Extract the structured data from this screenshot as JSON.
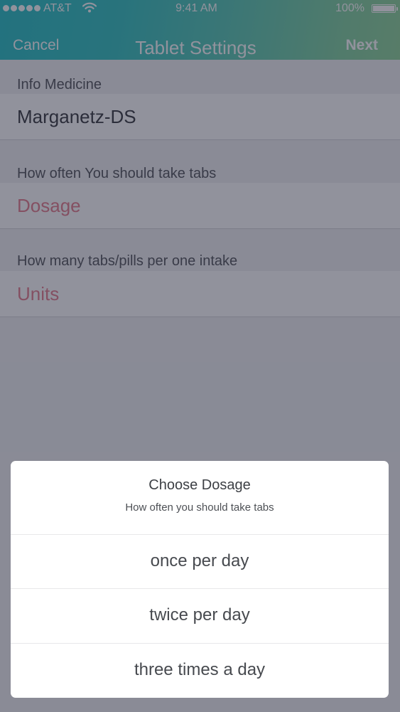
{
  "status_bar": {
    "carrier": "AT&T",
    "time": "9:41 AM",
    "battery": "100%",
    "battery_level": 1.0,
    "wifi_icon": "wifi-icon",
    "signal_icon": "signal-dots-icon"
  },
  "nav": {
    "cancel_label": "Cancel",
    "title": "Tablet Settings",
    "next_label": "Next"
  },
  "form": {
    "info_label": "Info Medicine",
    "medicine_name": "Marganetz-DS",
    "dosage_label": "How often You should take tabs",
    "dosage_placeholder": "Dosage",
    "units_label": "How many tabs/pills per one intake",
    "units_placeholder": "Units"
  },
  "action_sheet": {
    "title": "Choose Dosage",
    "subtitle": "How often you should take tabs",
    "options": [
      "once per day",
      "twice per day",
      "three times a day"
    ]
  },
  "colors": {
    "header_gradient_start": "#22bfc4",
    "header_gradient_end": "#8cd397",
    "placeholder": "#e57b8a",
    "overlay": "rgba(35,38,58,0.5)"
  }
}
